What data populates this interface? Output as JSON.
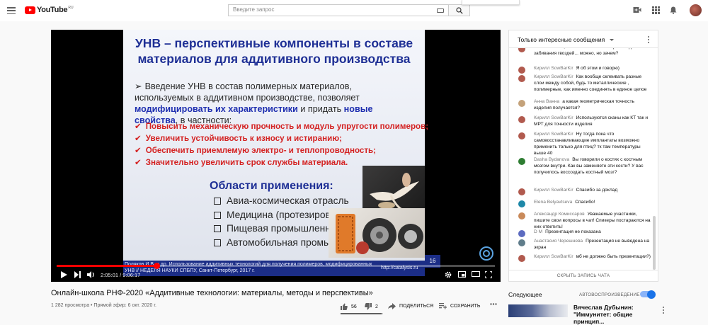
{
  "header": {
    "logo_text": "YouTube",
    "logo_region": "RU",
    "search_placeholder": "Введите запрос"
  },
  "video": {
    "slide": {
      "title_line1": "УНВ – перспективные компоненты в составе",
      "title_line2": "материалов для аддитивного производства",
      "intro_plain1": "Введение УНВ в состав полимерных материалов, используемых в аддитивном производстве, позволяет ",
      "intro_hl1": "модифицировать их характеристики",
      "intro_plain2": " и придать ",
      "intro_hl2": "новые свойства",
      "intro_plain3": ", в частности:",
      "checks": [
        "Повысить механическую прочность и модуль упругости полимеров;",
        "Увеличить устойчивость к износу и истиранию;",
        "Обеспечить приемлемую электро- и теплопроводность;",
        "Значительно увеличить срок службы материала."
      ],
      "areas_title": "Области применения:",
      "areas": [
        "Авиа-космическая отрасль",
        "Медицина (протезирование)",
        "Пищевая промышленность",
        "Автомобильная промышленность"
      ],
      "reference": "Поляков И.В. и др. Использование аддитивных технологий для получения полимеров, модифицированных УНВ // НЕДЕЛЯ НАУКИ СПБПУ, Санкт-Петербург, 2017 г.",
      "url": "http://catalysis.ru",
      "page_number": "16"
    },
    "player": {
      "time_display": "2:05:01 / 9:06:17",
      "progress_fraction": 0.228
    },
    "title": "Онлайн-школа РНФ-2020 «Аддитивные технологии: материалы, методы и перспективы»",
    "meta": "1 282 просмотра • Прямой эфир: 6 окт. 2020 г.",
    "likes": "56",
    "dislikes": "2",
    "like_fraction": 0.966,
    "share_label": "ПОДЕЛИТЬСЯ",
    "save_label": "СОХРАНИТЬ"
  },
  "chat": {
    "header": "Только интересные сообщения",
    "collapse_label": "СКРЫТЬ ЗАПИСЬ ЧАТА",
    "messages": [
      {
        "author": "",
        "text": "частного его, как использовать микроскоп для забивания гвоздей... можно, но зачем?",
        "avatar_color": "#b15a4e"
      },
      {
        "author": "Кирилл SowBarKir",
        "text": "Я об этом и говорю)",
        "avatar_color": "#b15a4e"
      },
      {
        "author": "Кирилл SowBarKir",
        "text": "Как вообще склеивать разные слои между собой, будь то металлические , полимерные, как именно соединять в единое целое",
        "avatar_color": "#b15a4e"
      },
      {
        "author": "Анна Ванна",
        "text": "а какая геометрическая точность изделия получается?",
        "avatar_color": "#c4a27a"
      },
      {
        "author": "Кирилл SowBarKir",
        "text": "Используются сканы как КТ так и МРТ для точности изделия",
        "avatar_color": "#b15a4e"
      },
      {
        "author": "Кирилл SowBarKir",
        "text": "Ну тогда пока что самовосстанавливающие имплантаты возможно применить только для птиц? тк там температуры выше 40",
        "avatar_color": "#b15a4e"
      },
      {
        "author": "Dasha Bydanova",
        "text": "Вы говорили о костях с костным мозгом внутри. Как вы заменяете эти кости? У вас получилось воссоздать костный мозг?",
        "avatar_color": "#2e7d32"
      },
      {
        "author": "Кирилл SowBarKir",
        "text": "Спасибо за доклад",
        "avatar_color": "#b15a4e"
      },
      {
        "author": "Elena Belyavtseva",
        "text": "Спасибо!",
        "avatar_color": "#1e88a8"
      },
      {
        "author": "Александр Комиссаров",
        "text": "Уважаемые участники, пишите свои вопросы в чат! Спикеры постараются на них ответить!",
        "avatar_color": "#c98a5a"
      },
      {
        "author": "D M",
        "text": "Презентация не показана",
        "avatar_color": "#5c6bc0"
      },
      {
        "author": "Анастасия Черешнева",
        "text": "Презентация не выведена на экран",
        "avatar_color": "#607d8b"
      },
      {
        "author": "Кирилл SowBarKir",
        "text": "мб не должно быть презентации?)",
        "avatar_color": "#b15a4e"
      }
    ]
  },
  "sidebar": {
    "up_next": "Следующее",
    "autoplay": "АВТОВОСПРОИЗВЕДЕНИЕ",
    "autoplay_on": true,
    "next_video_title": "Вячеслав Дубынин: \"Иммунитет: общие принцип..."
  },
  "colors": {
    "brand_red": "#ff0000",
    "slide_blue": "#1e2f95",
    "slide_red": "#d42222",
    "toggle_blue": "#1a73e8"
  }
}
